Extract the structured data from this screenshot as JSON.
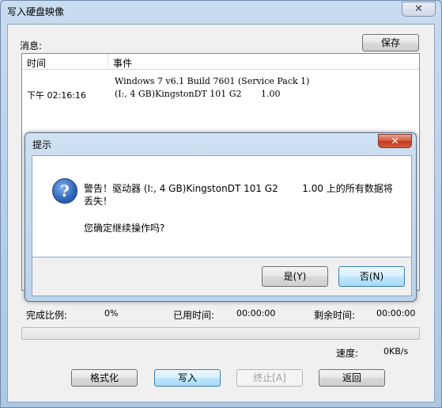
{
  "window": {
    "title": "写入硬盘映像",
    "close_glyph": "✕"
  },
  "messages_label": "消息:",
  "save_button": "保存",
  "log": {
    "columns": [
      "时间",
      "事件"
    ],
    "rows": [
      {
        "time": "",
        "event": "Windows 7 v6.1 Build 7601 (Service Pack 1)"
      },
      {
        "time": "下午 02:16:16",
        "event": "(I:, 4 GB)KingstonDT 101 G2       1.00"
      }
    ]
  },
  "dialog": {
    "title": "提示",
    "close_glyph": "✕",
    "icon_glyph": "?",
    "message_line1": "警告！驱动器 (I:, 4 GB)KingstonDT 101 G2        1.00 上的所有数据将",
    "message_line2": "丢失！",
    "question": "您确定继续操作吗?",
    "yes_button": "是(Y)",
    "no_button": "否(N)"
  },
  "status": {
    "completion_label": "完成比例:",
    "completion_value": "0%",
    "elapsed_label": "已用时间:",
    "elapsed_value": "00:00:00",
    "remaining_label": "剩余时间:",
    "remaining_value": "00:00:00",
    "speed_label": "速度:",
    "speed_value": "0KB/s",
    "progress_fraction": 0
  },
  "buttons": {
    "format": "格式化",
    "write": "写入",
    "stop": "终止[A]",
    "back": "返回"
  }
}
